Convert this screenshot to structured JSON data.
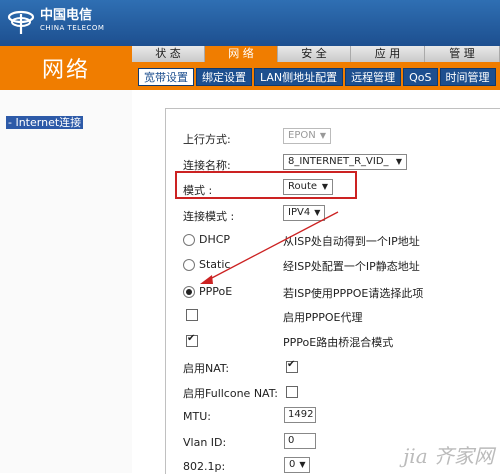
{
  "brand": {
    "cn": "中国电信",
    "en": "CHINA TELECOM"
  },
  "section_title": "网络",
  "top_tabs": [
    {
      "label": "状 态",
      "active": false
    },
    {
      "label": "网 络",
      "active": true
    },
    {
      "label": "安 全",
      "active": false
    },
    {
      "label": "应 用",
      "active": false
    },
    {
      "label": "管 理",
      "active": false
    }
  ],
  "sub_tabs": [
    {
      "label": "宽带设置",
      "active": true
    },
    {
      "label": "绑定设置",
      "active": false
    },
    {
      "label": "LAN侧地址配置",
      "active": false
    },
    {
      "label": "远程管理",
      "active": false
    },
    {
      "label": "QoS",
      "active": false
    },
    {
      "label": "时间管理",
      "active": false
    }
  ],
  "sidebar": {
    "items": [
      {
        "label": "- Internet连接"
      }
    ]
  },
  "form": {
    "uplink_label": "上行方式:",
    "uplink_value": "EPON",
    "conn_name_label": "连接名称:",
    "conn_name_value": "8_INTERNET_R_VID_",
    "mode_label": "模式 :",
    "mode_value": "Route",
    "conn_mode_label": "连接模式 :",
    "conn_mode_value": "IPV4",
    "dhcp_label": "DHCP",
    "dhcp_desc": "从ISP处自动得到一个IP地址",
    "static_label": "Static",
    "static_desc": "经ISP处配置一个IP静态地址",
    "pppoe_label": "PPPoE",
    "pppoe_desc": "若ISP使用PPPOE请选择此项",
    "pppoe_proxy_label": "启用PPPOE代理",
    "pppoe_bridge_label": "PPPoE路由桥混合模式",
    "nat_label": "启用NAT:",
    "fullcone_label": "启用Fullcone NAT:",
    "mtu_label": "MTU:",
    "mtu_value": "1492",
    "vlan_label": "Vlan ID:",
    "vlan_value": "0",
    "p8021_label": "802.1p:",
    "p8021_value": "0"
  },
  "state": {
    "selected_conn_type": "PPPoE",
    "pppoe_proxy": false,
    "pppoe_bridge": true,
    "nat": true,
    "fullcone_nat": false
  },
  "colors": {
    "accent": "#f07d00",
    "header_blue": "#1d4f8f",
    "highlight": "#cc2222"
  },
  "watermark": "jia 齐家网"
}
